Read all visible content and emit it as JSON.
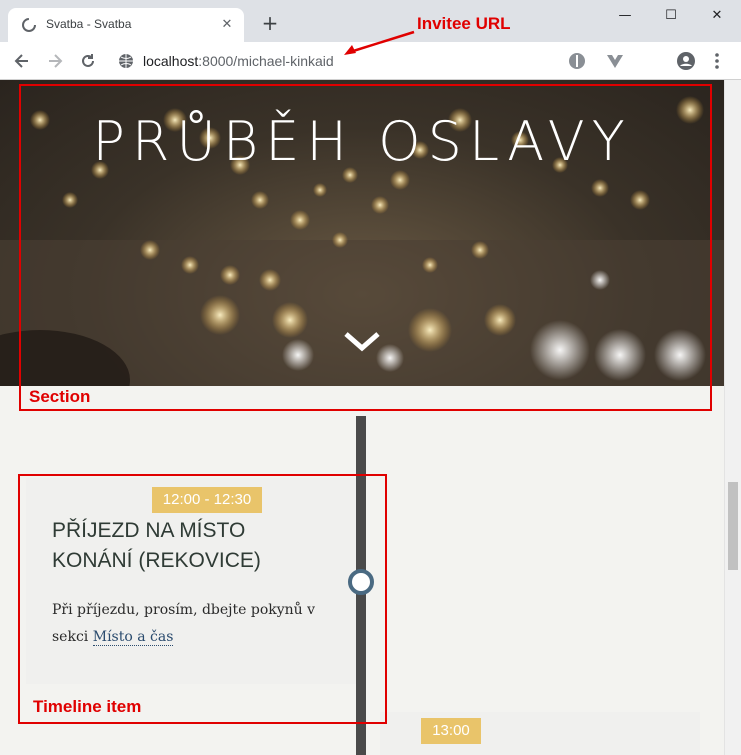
{
  "browser": {
    "tab_title": "Svatba - Svatba",
    "new_tab_symbol": "+",
    "url_host": "localhost",
    "url_path": ":8000/michael-kinkaid",
    "window_controls": [
      "—",
      "☐",
      "✕"
    ]
  },
  "hero": {
    "title": "PRŮBĚH OSLAVY"
  },
  "timeline": {
    "items": [
      {
        "time": "12:00 - 12:30",
        "heading": "PŘÍJEZD NA MÍSTO KONÁNÍ (REKOVICE)",
        "text_prefix": "Při příjezdu, prosím, dbejte pokynů v sekci ",
        "link_text": "Místo a čas"
      },
      {
        "time": "13:00"
      }
    ]
  },
  "annotations": {
    "invitee_url": "Invitee URL",
    "section": "Section",
    "timeline_item": "Timeline item"
  },
  "colors": {
    "annotation": "#e00000",
    "time_badge": "#e9c46a",
    "timeline_node": "#4a6a82"
  }
}
